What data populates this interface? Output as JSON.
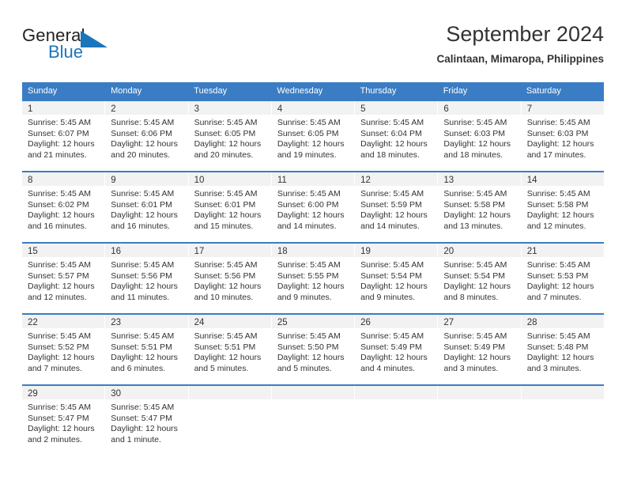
{
  "brand": {
    "name_part1": "General",
    "name_part2": "Blue",
    "accent_color": "#1b75bb"
  },
  "header": {
    "title": "September 2024",
    "subtitle": "Calintaan, Mimaropa, Philippines"
  },
  "calendar": {
    "header_bg": "#3b7dc4",
    "weekdays": [
      "Sunday",
      "Monday",
      "Tuesday",
      "Wednesday",
      "Thursday",
      "Friday",
      "Saturday"
    ],
    "weeks": [
      [
        {
          "day": "1",
          "sunrise": "Sunrise: 5:45 AM",
          "sunset": "Sunset: 6:07 PM",
          "daylight1": "Daylight: 12 hours",
          "daylight2": "and 21 minutes."
        },
        {
          "day": "2",
          "sunrise": "Sunrise: 5:45 AM",
          "sunset": "Sunset: 6:06 PM",
          "daylight1": "Daylight: 12 hours",
          "daylight2": "and 20 minutes."
        },
        {
          "day": "3",
          "sunrise": "Sunrise: 5:45 AM",
          "sunset": "Sunset: 6:05 PM",
          "daylight1": "Daylight: 12 hours",
          "daylight2": "and 20 minutes."
        },
        {
          "day": "4",
          "sunrise": "Sunrise: 5:45 AM",
          "sunset": "Sunset: 6:05 PM",
          "daylight1": "Daylight: 12 hours",
          "daylight2": "and 19 minutes."
        },
        {
          "day": "5",
          "sunrise": "Sunrise: 5:45 AM",
          "sunset": "Sunset: 6:04 PM",
          "daylight1": "Daylight: 12 hours",
          "daylight2": "and 18 minutes."
        },
        {
          "day": "6",
          "sunrise": "Sunrise: 5:45 AM",
          "sunset": "Sunset: 6:03 PM",
          "daylight1": "Daylight: 12 hours",
          "daylight2": "and 18 minutes."
        },
        {
          "day": "7",
          "sunrise": "Sunrise: 5:45 AM",
          "sunset": "Sunset: 6:03 PM",
          "daylight1": "Daylight: 12 hours",
          "daylight2": "and 17 minutes."
        }
      ],
      [
        {
          "day": "8",
          "sunrise": "Sunrise: 5:45 AM",
          "sunset": "Sunset: 6:02 PM",
          "daylight1": "Daylight: 12 hours",
          "daylight2": "and 16 minutes."
        },
        {
          "day": "9",
          "sunrise": "Sunrise: 5:45 AM",
          "sunset": "Sunset: 6:01 PM",
          "daylight1": "Daylight: 12 hours",
          "daylight2": "and 16 minutes."
        },
        {
          "day": "10",
          "sunrise": "Sunrise: 5:45 AM",
          "sunset": "Sunset: 6:01 PM",
          "daylight1": "Daylight: 12 hours",
          "daylight2": "and 15 minutes."
        },
        {
          "day": "11",
          "sunrise": "Sunrise: 5:45 AM",
          "sunset": "Sunset: 6:00 PM",
          "daylight1": "Daylight: 12 hours",
          "daylight2": "and 14 minutes."
        },
        {
          "day": "12",
          "sunrise": "Sunrise: 5:45 AM",
          "sunset": "Sunset: 5:59 PM",
          "daylight1": "Daylight: 12 hours",
          "daylight2": "and 14 minutes."
        },
        {
          "day": "13",
          "sunrise": "Sunrise: 5:45 AM",
          "sunset": "Sunset: 5:58 PM",
          "daylight1": "Daylight: 12 hours",
          "daylight2": "and 13 minutes."
        },
        {
          "day": "14",
          "sunrise": "Sunrise: 5:45 AM",
          "sunset": "Sunset: 5:58 PM",
          "daylight1": "Daylight: 12 hours",
          "daylight2": "and 12 minutes."
        }
      ],
      [
        {
          "day": "15",
          "sunrise": "Sunrise: 5:45 AM",
          "sunset": "Sunset: 5:57 PM",
          "daylight1": "Daylight: 12 hours",
          "daylight2": "and 12 minutes."
        },
        {
          "day": "16",
          "sunrise": "Sunrise: 5:45 AM",
          "sunset": "Sunset: 5:56 PM",
          "daylight1": "Daylight: 12 hours",
          "daylight2": "and 11 minutes."
        },
        {
          "day": "17",
          "sunrise": "Sunrise: 5:45 AM",
          "sunset": "Sunset: 5:56 PM",
          "daylight1": "Daylight: 12 hours",
          "daylight2": "and 10 minutes."
        },
        {
          "day": "18",
          "sunrise": "Sunrise: 5:45 AM",
          "sunset": "Sunset: 5:55 PM",
          "daylight1": "Daylight: 12 hours",
          "daylight2": "and 9 minutes."
        },
        {
          "day": "19",
          "sunrise": "Sunrise: 5:45 AM",
          "sunset": "Sunset: 5:54 PM",
          "daylight1": "Daylight: 12 hours",
          "daylight2": "and 9 minutes."
        },
        {
          "day": "20",
          "sunrise": "Sunrise: 5:45 AM",
          "sunset": "Sunset: 5:54 PM",
          "daylight1": "Daylight: 12 hours",
          "daylight2": "and 8 minutes."
        },
        {
          "day": "21",
          "sunrise": "Sunrise: 5:45 AM",
          "sunset": "Sunset: 5:53 PM",
          "daylight1": "Daylight: 12 hours",
          "daylight2": "and 7 minutes."
        }
      ],
      [
        {
          "day": "22",
          "sunrise": "Sunrise: 5:45 AM",
          "sunset": "Sunset: 5:52 PM",
          "daylight1": "Daylight: 12 hours",
          "daylight2": "and 7 minutes."
        },
        {
          "day": "23",
          "sunrise": "Sunrise: 5:45 AM",
          "sunset": "Sunset: 5:51 PM",
          "daylight1": "Daylight: 12 hours",
          "daylight2": "and 6 minutes."
        },
        {
          "day": "24",
          "sunrise": "Sunrise: 5:45 AM",
          "sunset": "Sunset: 5:51 PM",
          "daylight1": "Daylight: 12 hours",
          "daylight2": "and 5 minutes."
        },
        {
          "day": "25",
          "sunrise": "Sunrise: 5:45 AM",
          "sunset": "Sunset: 5:50 PM",
          "daylight1": "Daylight: 12 hours",
          "daylight2": "and 5 minutes."
        },
        {
          "day": "26",
          "sunrise": "Sunrise: 5:45 AM",
          "sunset": "Sunset: 5:49 PM",
          "daylight1": "Daylight: 12 hours",
          "daylight2": "and 4 minutes."
        },
        {
          "day": "27",
          "sunrise": "Sunrise: 5:45 AM",
          "sunset": "Sunset: 5:49 PM",
          "daylight1": "Daylight: 12 hours",
          "daylight2": "and 3 minutes."
        },
        {
          "day": "28",
          "sunrise": "Sunrise: 5:45 AM",
          "sunset": "Sunset: 5:48 PM",
          "daylight1": "Daylight: 12 hours",
          "daylight2": "and 3 minutes."
        }
      ],
      [
        {
          "day": "29",
          "sunrise": "Sunrise: 5:45 AM",
          "sunset": "Sunset: 5:47 PM",
          "daylight1": "Daylight: 12 hours",
          "daylight2": "and 2 minutes."
        },
        {
          "day": "30",
          "sunrise": "Sunrise: 5:45 AM",
          "sunset": "Sunset: 5:47 PM",
          "daylight1": "Daylight: 12 hours",
          "daylight2": "and 1 minute."
        },
        {
          "day": "",
          "sunrise": "",
          "sunset": "",
          "daylight1": "",
          "daylight2": ""
        },
        {
          "day": "",
          "sunrise": "",
          "sunset": "",
          "daylight1": "",
          "daylight2": ""
        },
        {
          "day": "",
          "sunrise": "",
          "sunset": "",
          "daylight1": "",
          "daylight2": ""
        },
        {
          "day": "",
          "sunrise": "",
          "sunset": "",
          "daylight1": "",
          "daylight2": ""
        },
        {
          "day": "",
          "sunrise": "",
          "sunset": "",
          "daylight1": "",
          "daylight2": ""
        }
      ]
    ]
  }
}
